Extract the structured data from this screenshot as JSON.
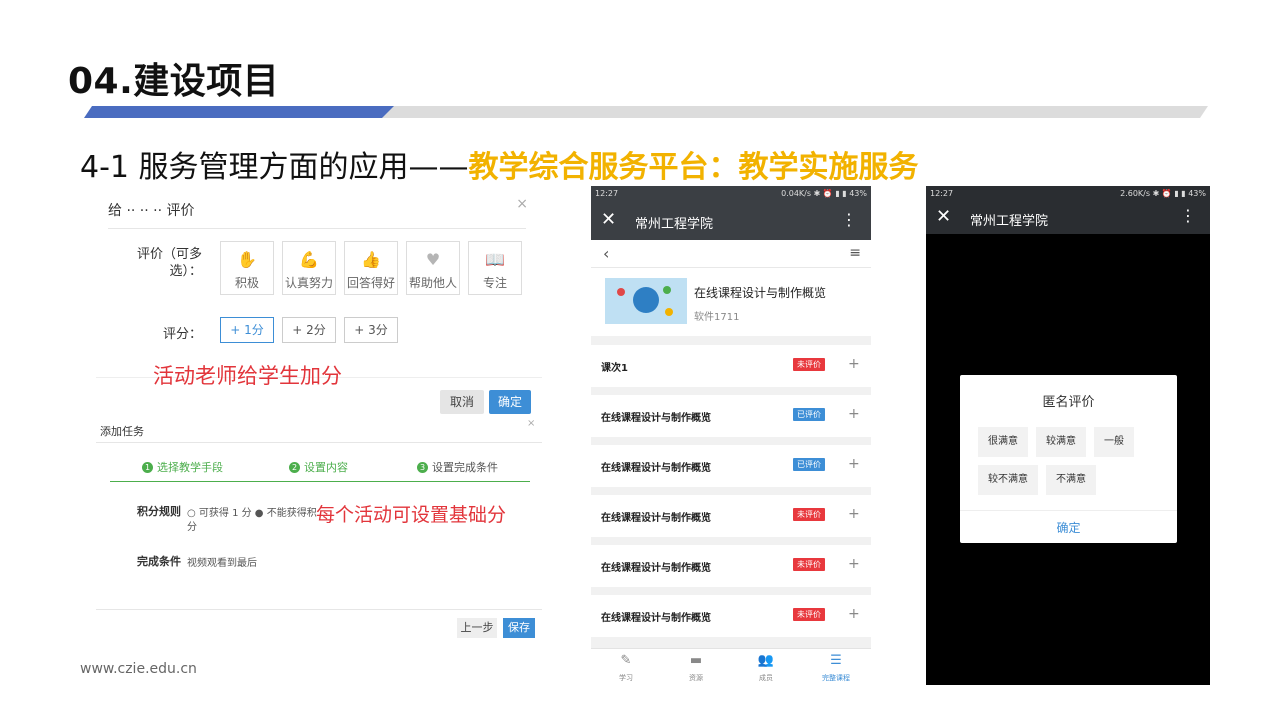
{
  "slide": {
    "title": "04.建设项目",
    "subtitle_prefix": "4-1 服务管理方面的应用——",
    "subtitle_highlight": "教学综合服务平台：教学实施服务",
    "footer_url": "www.czie.edu.cn",
    "accent_blue": "#4a6cc0",
    "accent_yellow": "#f2b200"
  },
  "evaluation_dialog": {
    "title": "给 ·· ·· ·· 评价",
    "close": "×",
    "badges_label": "评价（可多选）：",
    "badges": [
      {
        "icon": "hand-icon",
        "glyph": "✋",
        "label": "积极"
      },
      {
        "icon": "arm-icon",
        "glyph": "💪",
        "label": "认真努力"
      },
      {
        "icon": "thumbs-up-icon",
        "glyph": "👍",
        "label": "回答得好"
      },
      {
        "icon": "heart-icon",
        "glyph": "♥",
        "label": "帮助他人"
      },
      {
        "icon": "book-icon",
        "glyph": "📖",
        "label": "专注"
      }
    ],
    "score_label": "评分：",
    "scores": [
      "+ 1分",
      "+ 2分",
      "+ 3分"
    ],
    "selected_score": "+ 1分",
    "cancel": "取消",
    "confirm": "确定"
  },
  "annotations": {
    "teacher_points": "活动老师给学生加分",
    "base_score": "每个活动可设置基础分"
  },
  "add_task": {
    "title": "添加任务",
    "close": "×",
    "steps": [
      {
        "num": "1",
        "label": "选择教学手段"
      },
      {
        "num": "2",
        "label": "设置内容"
      },
      {
        "num": "3",
        "label": "设置完成条件"
      }
    ],
    "points_rule_label": "积分规则",
    "points_rule_text_1": "○ 可获得 1 分 ● 不能获得积",
    "points_rule_text_2": "分",
    "completion_label": "完成条件",
    "completion_text": "视频观看到最后",
    "prev": "上一步",
    "save": "保存"
  },
  "phone_course": {
    "status_time": "12:27",
    "status_right": "0.04K/s ✱ ⏰ ▮ ▮ 43%",
    "app_title": "常州工程学院",
    "close_glyph": "✕",
    "more_glyph": "⋮",
    "back_glyph": "‹",
    "menu_glyph": "≡",
    "course_name": "在线课程设计与制作概览",
    "course_class": "软件1711",
    "lessons": [
      {
        "name": "课次1",
        "status": "未评价",
        "color": "red"
      },
      {
        "name": "在线课程设计与制作概览",
        "status": "已评价",
        "color": "blue"
      },
      {
        "name": "在线课程设计与制作概览",
        "status": "已评价",
        "color": "blue"
      },
      {
        "name": "在线课程设计与制作概览",
        "status": "未评价",
        "color": "red"
      },
      {
        "name": "在线课程设计与制作概览",
        "status": "未评价",
        "color": "red"
      },
      {
        "name": "在线课程设计与制作概览",
        "status": "未评价",
        "color": "red"
      }
    ],
    "plus_glyph": "+",
    "bottom_nav": [
      {
        "icon": "pencil-icon",
        "glyph": "✎",
        "label": "学习"
      },
      {
        "icon": "folder-icon",
        "glyph": "▬",
        "label": "资源"
      },
      {
        "icon": "members-icon",
        "glyph": "👥",
        "label": "成员"
      },
      {
        "icon": "list-icon",
        "glyph": "☰",
        "label": "完整课程"
      }
    ],
    "active_nav": "完整课程"
  },
  "phone_rating": {
    "status_time": "12:27",
    "status_right": "2.60K/s ✱ ⏰ ▮ ▮ 43%",
    "app_title": "常州工程学院",
    "close_glyph": "✕",
    "more_glyph": "⋮",
    "modal_title": "匿名评价",
    "options": [
      "很满意",
      "较满意",
      "一般",
      "较不满意",
      "不满意"
    ],
    "confirm": "确定"
  }
}
